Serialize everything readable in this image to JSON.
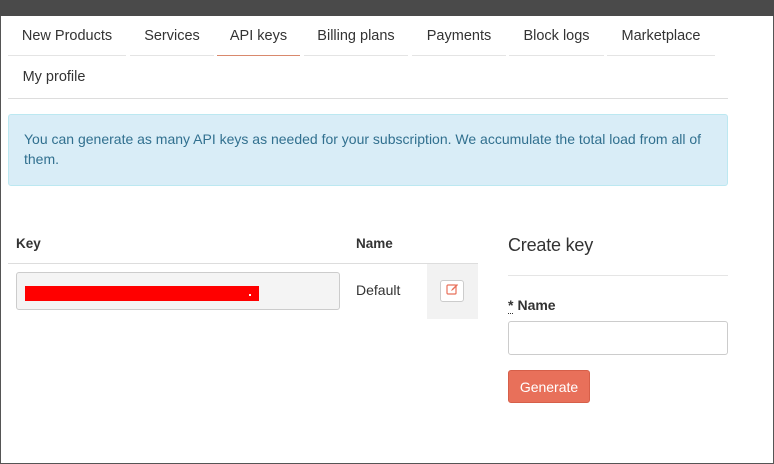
{
  "nav": {
    "tabs": [
      {
        "label": "New Products"
      },
      {
        "label": "Services"
      },
      {
        "label": "API keys",
        "active": true
      },
      {
        "label": "Billing plans"
      },
      {
        "label": "Payments"
      },
      {
        "label": "Block logs"
      },
      {
        "label": "Marketplace"
      },
      {
        "label": "My profile"
      }
    ]
  },
  "alert": {
    "text": "You can generate as many API keys as needed for your subscription. We accumulate the total load from all of them."
  },
  "keys_table": {
    "headers": {
      "key": "Key",
      "name": "Name"
    },
    "rows": [
      {
        "key_value_redacted": true,
        "name": "Default",
        "edit_icon": "edit-icon"
      }
    ]
  },
  "create_key": {
    "title": "Create key",
    "required_mark": "*",
    "name_label": "Name",
    "name_value": "",
    "generate_label": "Generate"
  },
  "colors": {
    "accent": "#e8705a",
    "alert_bg": "#d9edf7",
    "alert_text": "#31708f",
    "redaction": "#ff0000",
    "active_tab_underline": "#d9896d"
  }
}
